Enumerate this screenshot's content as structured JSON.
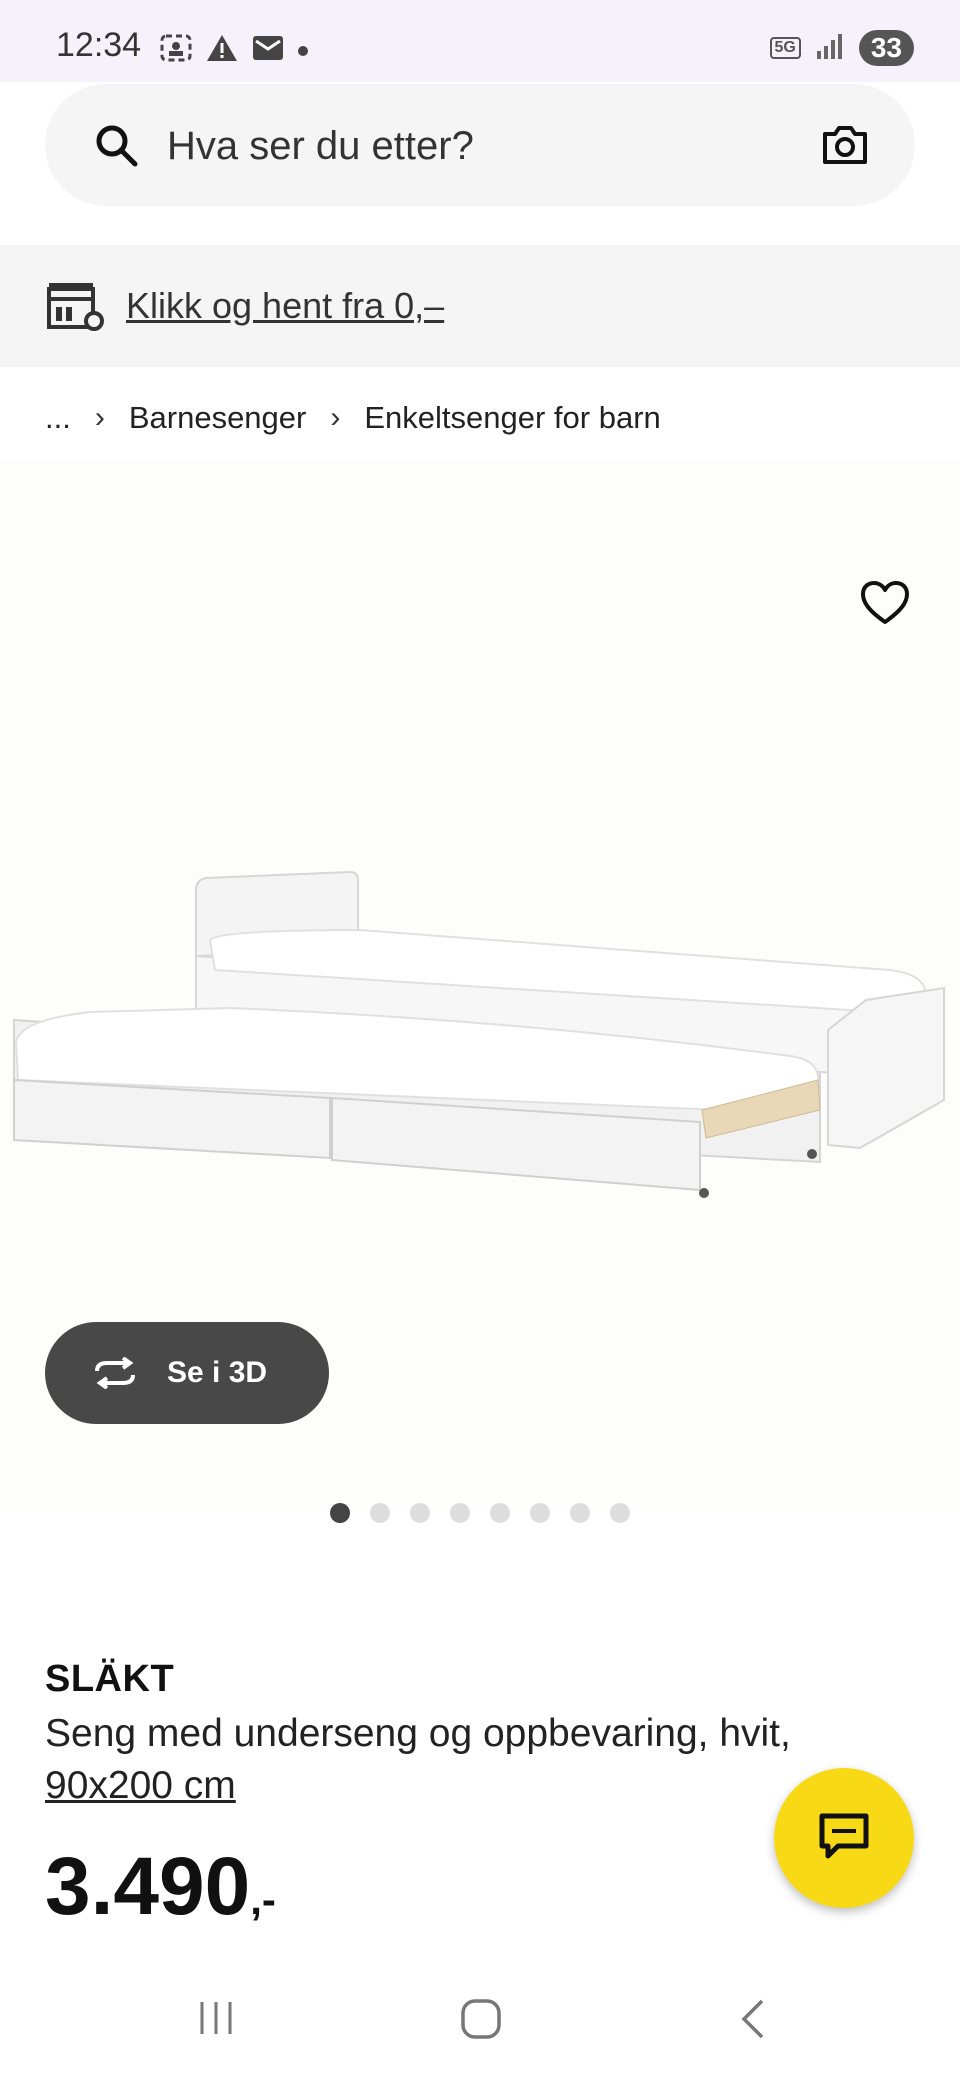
{
  "status_bar": {
    "time": "12:34",
    "network": "5G",
    "battery": "33"
  },
  "search": {
    "placeholder": "Hva ser du etter?"
  },
  "promo": {
    "link_text": "Klikk og hent fra 0,–"
  },
  "breadcrumb": {
    "ellipsis": "...",
    "items": [
      "Barnesenger",
      "Enkeltsenger for barn"
    ]
  },
  "gallery": {
    "view_3d_label": "Se i 3D",
    "dot_count": 8,
    "active_index": 0
  },
  "product": {
    "brand": "SLÄKT",
    "description": "Seng med underseng og oppbevaring, hvit,",
    "size": "90x200 cm",
    "price": "3.490",
    "price_suffix": ",-"
  },
  "colors": {
    "chat_fab": "#f7d915",
    "view_3d_bg": "#484848",
    "status_bg": "#f6f2fb"
  }
}
